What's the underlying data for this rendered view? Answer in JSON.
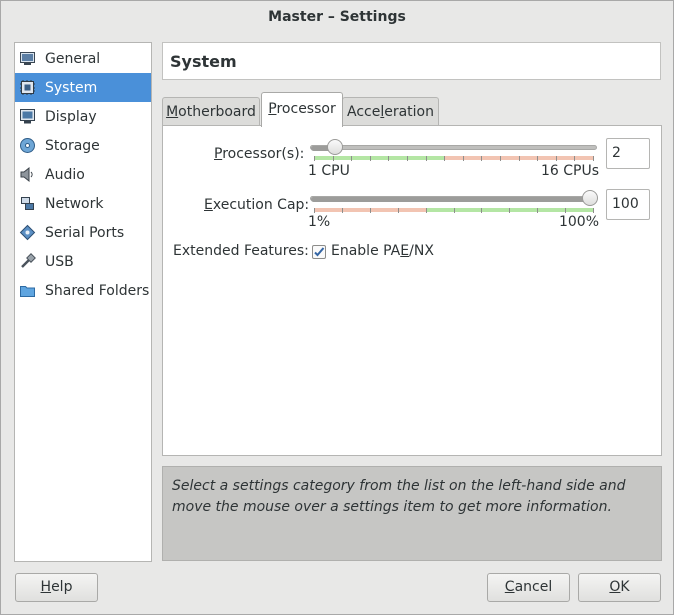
{
  "window": {
    "title": "Master – Settings"
  },
  "sidebar": {
    "items": [
      {
        "label": "General",
        "icon": "monitor-icon"
      },
      {
        "label": "System",
        "icon": "chip-icon",
        "selected": true
      },
      {
        "label": "Display",
        "icon": "display-icon"
      },
      {
        "label": "Storage",
        "icon": "disc-icon"
      },
      {
        "label": "Audio",
        "icon": "speaker-icon"
      },
      {
        "label": "Network",
        "icon": "network-icon"
      },
      {
        "label": "Serial Ports",
        "icon": "serial-port-icon"
      },
      {
        "label": "USB",
        "icon": "usb-icon"
      },
      {
        "label": "Shared Folders",
        "icon": "folder-icon"
      }
    ]
  },
  "header": {
    "title": "System"
  },
  "tabs": {
    "motherboard": {
      "pre": "",
      "key": "M",
      "post": "otherboard"
    },
    "processor": {
      "pre": "",
      "key": "P",
      "post": "rocessor"
    },
    "acceleration": {
      "pre": "Acce",
      "key": "l",
      "post": "eration"
    }
  },
  "processor": {
    "cpus": {
      "label_key": "P",
      "label_rest": "rocessor(s):",
      "value": "2",
      "min_label": "1 CPU",
      "max_label": "16 CPUs",
      "min": 1,
      "max": 16,
      "current": 2
    },
    "exec_cap": {
      "label_key": "E",
      "label_rest": "xecution Cap:",
      "value": "100",
      "min_label": "1%",
      "max_label": "100%",
      "min": 1,
      "max": 100,
      "current": 100
    },
    "extended": {
      "label": "Extended Features:",
      "checkbox_pre": "Enable PA",
      "checkbox_key": "E",
      "checkbox_post": "/NX",
      "checked": true
    }
  },
  "info": {
    "text": "Select a settings category from the list on the left-hand side and move the mouse over a settings item to get more information."
  },
  "buttons": {
    "help": {
      "key": "H",
      "rest": "elp"
    },
    "cancel": {
      "key": "C",
      "rest": "ancel"
    },
    "ok": {
      "key": "O",
      "rest": "K"
    }
  },
  "colors": {
    "selection": "#4a90d9",
    "scale_green": "#b4e6a4",
    "scale_red": "#f2c4b2"
  }
}
